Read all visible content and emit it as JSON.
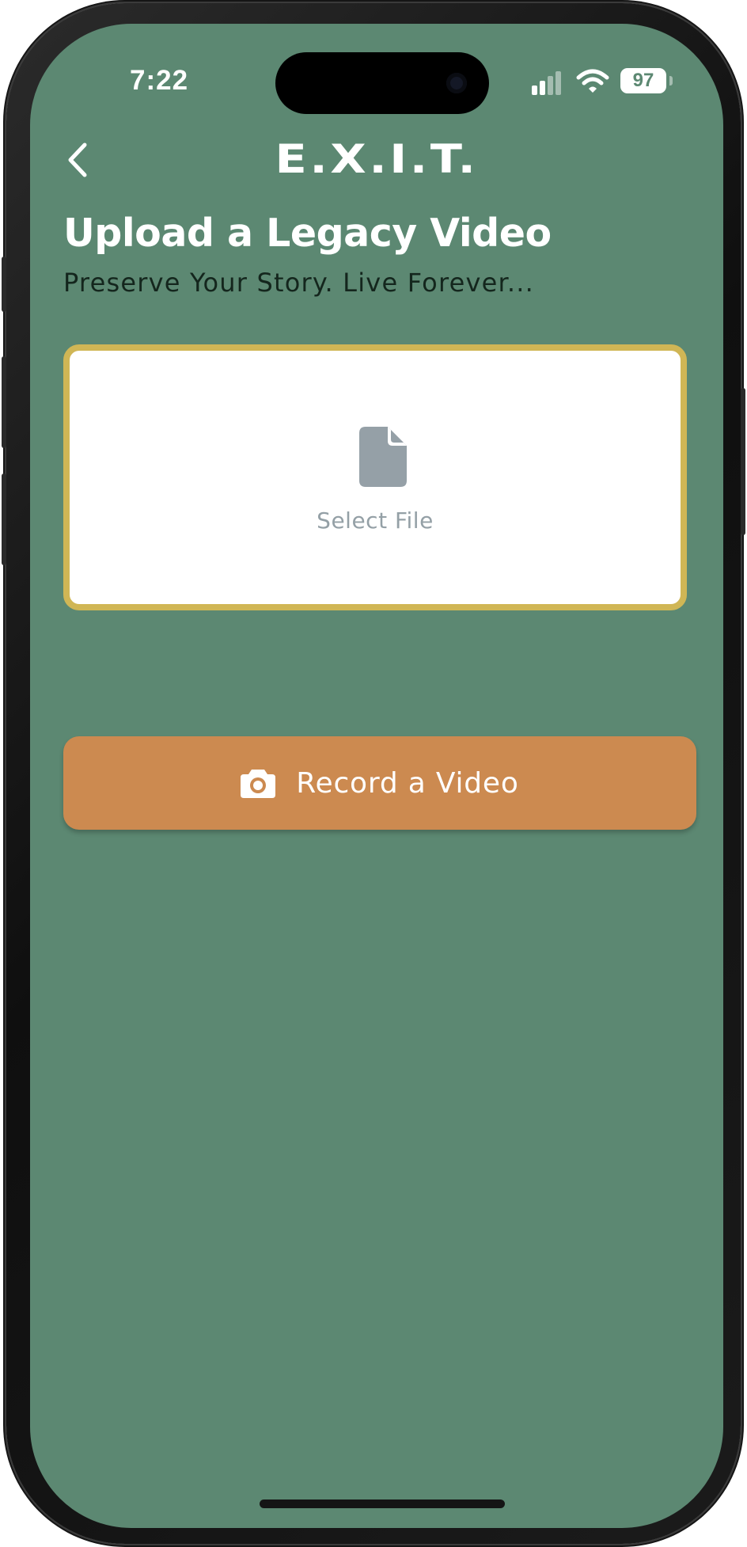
{
  "status_bar": {
    "time": "7:22",
    "battery": "97",
    "signal_icon": "cellular-signal-icon",
    "wifi_icon": "wifi-icon"
  },
  "header": {
    "back_icon": "chevron-left-icon",
    "logo_text": "E.X.I.T."
  },
  "page": {
    "title": "Upload a Legacy Video",
    "subtitle": "Preserve Your Story. Live Forever..."
  },
  "file_select": {
    "icon": "file-icon",
    "label": "Select File"
  },
  "record_button": {
    "icon": "camera-icon",
    "label": "Record a Video"
  },
  "colors": {
    "background": "#5c8872",
    "accent_border": "#d0b655",
    "button": "#cc8a50",
    "muted_text": "#94a0a6"
  }
}
